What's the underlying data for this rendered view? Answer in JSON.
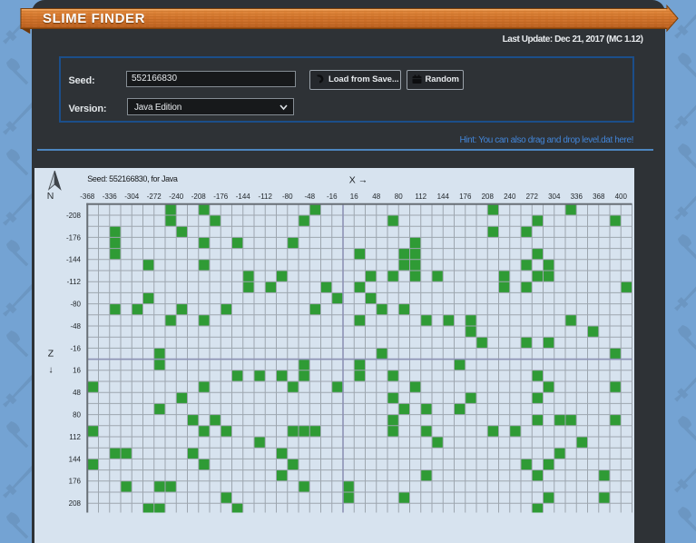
{
  "header": {
    "title": "SLIME FINDER",
    "last_update": "Last Update: Dec 21, 2017 (MC 1.12)"
  },
  "form": {
    "seed_label": "Seed:",
    "seed_value": "552166830",
    "load_button_label": "Load from Save...",
    "random_button_label": "Random",
    "version_label": "Version:",
    "version_value": "Java Edition",
    "hint": "Hint: You can also drag and drop level.dat here!"
  },
  "map": {
    "caption": "Seed: 552166830, for Java",
    "x_axis_label": "X",
    "x_axis_arrow": "→",
    "z_axis_label": "Z",
    "z_axis_arrow": "↓",
    "compass_label": "N",
    "x_tick_labels": [
      -368,
      -336,
      -304,
      -272,
      -240,
      -208,
      -176,
      -144,
      -112,
      -80,
      -48,
      -16,
      16,
      48,
      80,
      112,
      144,
      176,
      208,
      240,
      272,
      304,
      336,
      368,
      400
    ],
    "z_tick_labels": [
      -208,
      -176,
      -144,
      -112,
      -80,
      -48,
      -16,
      16,
      48,
      80,
      112,
      144,
      176,
      208
    ],
    "chunk_x_range": [
      -23,
      25
    ],
    "chunk_z_range": [
      -14,
      13
    ],
    "blocks_per_chunk": 16,
    "colors": {
      "map_background": "#d7e3ef",
      "grid_line": "#9da6af",
      "grid_border": "#686f76",
      "axis_origin_line": "#8d92b5",
      "slime_chunk": "#2f9b35",
      "tick_text": "#23282c"
    },
    "slime_chunks": [
      [
        -16,
        -14
      ],
      [
        -13,
        -14
      ],
      [
        -3,
        -14
      ],
      [
        13,
        -14
      ],
      [
        20,
        -14
      ],
      [
        -16,
        -13
      ],
      [
        -12,
        -13
      ],
      [
        -4,
        -13
      ],
      [
        4,
        -13
      ],
      [
        17,
        -13
      ],
      [
        24,
        -13
      ],
      [
        -21,
        -12
      ],
      [
        -15,
        -12
      ],
      [
        13,
        -12
      ],
      [
        16,
        -12
      ],
      [
        -21,
        -11
      ],
      [
        -13,
        -11
      ],
      [
        -10,
        -11
      ],
      [
        -5,
        -11
      ],
      [
        6,
        -11
      ],
      [
        -21,
        -10
      ],
      [
        1,
        -10
      ],
      [
        5,
        -10
      ],
      [
        6,
        -10
      ],
      [
        17,
        -10
      ],
      [
        -18,
        -9
      ],
      [
        -13,
        -9
      ],
      [
        5,
        -9
      ],
      [
        6,
        -9
      ],
      [
        16,
        -9
      ],
      [
        18,
        -9
      ],
      [
        -9,
        -8
      ],
      [
        -6,
        -8
      ],
      [
        2,
        -8
      ],
      [
        4,
        -8
      ],
      [
        6,
        -8
      ],
      [
        8,
        -8
      ],
      [
        14,
        -8
      ],
      [
        17,
        -8
      ],
      [
        18,
        -8
      ],
      [
        -9,
        -7
      ],
      [
        -7,
        -7
      ],
      [
        -2,
        -7
      ],
      [
        1,
        -7
      ],
      [
        14,
        -7
      ],
      [
        16,
        -7
      ],
      [
        25,
        -7
      ],
      [
        -18,
        -6
      ],
      [
        -1,
        -6
      ],
      [
        2,
        -6
      ],
      [
        -21,
        -5
      ],
      [
        -19,
        -5
      ],
      [
        -15,
        -5
      ],
      [
        -11,
        -5
      ],
      [
        -3,
        -5
      ],
      [
        3,
        -5
      ],
      [
        5,
        -5
      ],
      [
        -16,
        -4
      ],
      [
        -13,
        -4
      ],
      [
        1,
        -4
      ],
      [
        7,
        -4
      ],
      [
        9,
        -4
      ],
      [
        11,
        -4
      ],
      [
        20,
        -4
      ],
      [
        11,
        -3
      ],
      [
        22,
        -3
      ],
      [
        12,
        -2
      ],
      [
        16,
        -2
      ],
      [
        18,
        -2
      ],
      [
        -17,
        -1
      ],
      [
        3,
        -1
      ],
      [
        24,
        -1
      ],
      [
        -17,
        0
      ],
      [
        -4,
        0
      ],
      [
        1,
        0
      ],
      [
        10,
        0
      ],
      [
        -10,
        1
      ],
      [
        -8,
        1
      ],
      [
        -6,
        1
      ],
      [
        -4,
        1
      ],
      [
        1,
        1
      ],
      [
        4,
        1
      ],
      [
        17,
        1
      ],
      [
        -23,
        2
      ],
      [
        -13,
        2
      ],
      [
        -5,
        2
      ],
      [
        -1,
        2
      ],
      [
        6,
        2
      ],
      [
        18,
        2
      ],
      [
        24,
        2
      ],
      [
        -15,
        3
      ],
      [
        4,
        3
      ],
      [
        11,
        3
      ],
      [
        17,
        3
      ],
      [
        -17,
        4
      ],
      [
        5,
        4
      ],
      [
        7,
        4
      ],
      [
        10,
        4
      ],
      [
        -14,
        5
      ],
      [
        -12,
        5
      ],
      [
        4,
        5
      ],
      [
        17,
        5
      ],
      [
        19,
        5
      ],
      [
        20,
        5
      ],
      [
        24,
        5
      ],
      [
        -23,
        6
      ],
      [
        -13,
        6
      ],
      [
        -11,
        6
      ],
      [
        -5,
        6
      ],
      [
        -4,
        6
      ],
      [
        -3,
        6
      ],
      [
        4,
        6
      ],
      [
        7,
        6
      ],
      [
        13,
        6
      ],
      [
        15,
        6
      ],
      [
        -8,
        7
      ],
      [
        8,
        7
      ],
      [
        21,
        7
      ],
      [
        -21,
        8
      ],
      [
        -20,
        8
      ],
      [
        -14,
        8
      ],
      [
        -6,
        8
      ],
      [
        19,
        8
      ],
      [
        -23,
        9
      ],
      [
        -13,
        9
      ],
      [
        -5,
        9
      ],
      [
        16,
        9
      ],
      [
        18,
        9
      ],
      [
        -6,
        10
      ],
      [
        7,
        10
      ],
      [
        17,
        10
      ],
      [
        23,
        10
      ],
      [
        -20,
        11
      ],
      [
        -17,
        11
      ],
      [
        -16,
        11
      ],
      [
        -4,
        11
      ],
      [
        0,
        11
      ],
      [
        -11,
        12
      ],
      [
        0,
        12
      ],
      [
        5,
        12
      ],
      [
        18,
        12
      ],
      [
        23,
        12
      ],
      [
        -18,
        13
      ],
      [
        -17,
        13
      ],
      [
        -10,
        13
      ],
      [
        17,
        13
      ]
    ]
  },
  "chart_data": {
    "type": "heatmap",
    "title": "Slime chunk map for seed 552166830 (Java Edition)",
    "x_range_blocks": [
      -368,
      416
    ],
    "z_range_blocks": [
      -224,
      224
    ],
    "cell_size_blocks": 16,
    "slime_chunk_coords_in_chunks": [
      [
        -16,
        -14
      ],
      [
        -13,
        -14
      ],
      [
        -3,
        -14
      ],
      [
        13,
        -14
      ],
      [
        20,
        -14
      ],
      [
        -16,
        -13
      ],
      [
        -12,
        -13
      ],
      [
        -4,
        -13
      ],
      [
        4,
        -13
      ],
      [
        17,
        -13
      ],
      [
        24,
        -13
      ],
      [
        -21,
        -12
      ],
      [
        -15,
        -12
      ],
      [
        13,
        -12
      ],
      [
        16,
        -12
      ],
      [
        -21,
        -11
      ],
      [
        -13,
        -11
      ],
      [
        -10,
        -11
      ],
      [
        -5,
        -11
      ],
      [
        6,
        -11
      ],
      [
        -21,
        -10
      ],
      [
        1,
        -10
      ],
      [
        5,
        -10
      ],
      [
        6,
        -10
      ],
      [
        17,
        -10
      ],
      [
        -18,
        -9
      ],
      [
        -13,
        -9
      ],
      [
        5,
        -9
      ],
      [
        6,
        -9
      ],
      [
        16,
        -9
      ],
      [
        18,
        -9
      ],
      [
        -9,
        -8
      ],
      [
        -6,
        -8
      ],
      [
        2,
        -8
      ],
      [
        4,
        -8
      ],
      [
        6,
        -8
      ],
      [
        8,
        -8
      ],
      [
        14,
        -8
      ],
      [
        17,
        -8
      ],
      [
        18,
        -8
      ],
      [
        -9,
        -7
      ],
      [
        -7,
        -7
      ],
      [
        -2,
        -7
      ],
      [
        1,
        -7
      ],
      [
        14,
        -7
      ],
      [
        16,
        -7
      ],
      [
        25,
        -7
      ],
      [
        -18,
        -6
      ],
      [
        -1,
        -6
      ],
      [
        2,
        -6
      ],
      [
        -21,
        -5
      ],
      [
        -19,
        -5
      ],
      [
        -15,
        -5
      ],
      [
        -11,
        -5
      ],
      [
        -3,
        -5
      ],
      [
        3,
        -5
      ],
      [
        5,
        -5
      ],
      [
        -16,
        -4
      ],
      [
        -13,
        -4
      ],
      [
        1,
        -4
      ],
      [
        7,
        -4
      ],
      [
        9,
        -4
      ],
      [
        11,
        -4
      ],
      [
        20,
        -4
      ],
      [
        11,
        -3
      ],
      [
        22,
        -3
      ],
      [
        12,
        -2
      ],
      [
        16,
        -2
      ],
      [
        18,
        -2
      ],
      [
        -17,
        -1
      ],
      [
        3,
        -1
      ],
      [
        24,
        -1
      ],
      [
        -17,
        0
      ],
      [
        -4,
        0
      ],
      [
        1,
        0
      ],
      [
        10,
        0
      ],
      [
        -10,
        1
      ],
      [
        -8,
        1
      ],
      [
        -6,
        1
      ],
      [
        -4,
        1
      ],
      [
        1,
        1
      ],
      [
        4,
        1
      ],
      [
        17,
        1
      ],
      [
        -23,
        2
      ],
      [
        -13,
        2
      ],
      [
        -5,
        2
      ],
      [
        -1,
        2
      ],
      [
        6,
        2
      ],
      [
        18,
        2
      ],
      [
        24,
        2
      ],
      [
        -15,
        3
      ],
      [
        4,
        3
      ],
      [
        11,
        3
      ],
      [
        17,
        3
      ],
      [
        -17,
        4
      ],
      [
        5,
        4
      ],
      [
        7,
        4
      ],
      [
        10,
        4
      ],
      [
        -14,
        5
      ],
      [
        -12,
        5
      ],
      [
        4,
        5
      ],
      [
        17,
        5
      ],
      [
        19,
        5
      ],
      [
        20,
        5
      ],
      [
        24,
        5
      ],
      [
        -23,
        6
      ],
      [
        -13,
        6
      ],
      [
        -11,
        6
      ],
      [
        -5,
        6
      ],
      [
        -4,
        6
      ],
      [
        -3,
        6
      ],
      [
        4,
        6
      ],
      [
        7,
        6
      ],
      [
        13,
        6
      ],
      [
        15,
        6
      ],
      [
        -8,
        7
      ],
      [
        8,
        7
      ],
      [
        21,
        7
      ],
      [
        -21,
        8
      ],
      [
        -20,
        8
      ],
      [
        -14,
        8
      ],
      [
        -6,
        8
      ],
      [
        19,
        8
      ],
      [
        -23,
        9
      ],
      [
        -13,
        9
      ],
      [
        -5,
        9
      ],
      [
        16,
        9
      ],
      [
        18,
        9
      ],
      [
        -6,
        10
      ],
      [
        7,
        10
      ],
      [
        17,
        10
      ],
      [
        23,
        10
      ],
      [
        -20,
        11
      ],
      [
        -17,
        11
      ],
      [
        -16,
        11
      ],
      [
        -4,
        11
      ],
      [
        0,
        11
      ],
      [
        -11,
        12
      ],
      [
        0,
        12
      ],
      [
        5,
        12
      ],
      [
        18,
        12
      ],
      [
        23,
        12
      ],
      [
        -18,
        13
      ],
      [
        -17,
        13
      ],
      [
        -10,
        13
      ],
      [
        17,
        13
      ]
    ]
  }
}
